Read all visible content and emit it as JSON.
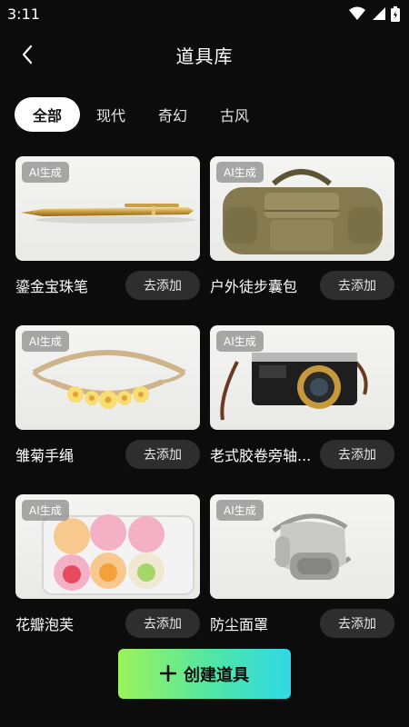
{
  "status": {
    "time": "3:11"
  },
  "header": {
    "title": "道具库"
  },
  "tabs": [
    {
      "label": "全部",
      "active": true
    },
    {
      "label": "现代",
      "active": false
    },
    {
      "label": "奇幻",
      "active": false
    },
    {
      "label": "古风",
      "active": false
    }
  ],
  "items": [
    {
      "name": "鎏金宝珠笔",
      "badge": "AI生成",
      "action": "去添加",
      "image": "gold-pen"
    },
    {
      "name": "户外徒步囊包",
      "badge": "AI生成",
      "action": "去添加",
      "image": "duffel-bag"
    },
    {
      "name": "雏菊手绳",
      "badge": "AI生成",
      "action": "去添加",
      "image": "daisy-bracelet"
    },
    {
      "name": "老式胶卷旁轴...",
      "badge": "AI生成",
      "action": "去添加",
      "image": "film-camera"
    },
    {
      "name": "花瓣泡芙",
      "badge": "AI生成",
      "action": "去添加",
      "image": "petal-puffs"
    },
    {
      "name": "防尘面罩",
      "badge": "AI生成",
      "action": "去添加",
      "image": "dust-mask"
    }
  ],
  "create_button": {
    "label": "创建道具",
    "icon": "plus-icon"
  },
  "colors": {
    "background": "#0c0c0c",
    "accent_start": "#9cf35a",
    "accent_end": "#2fd9e6"
  }
}
